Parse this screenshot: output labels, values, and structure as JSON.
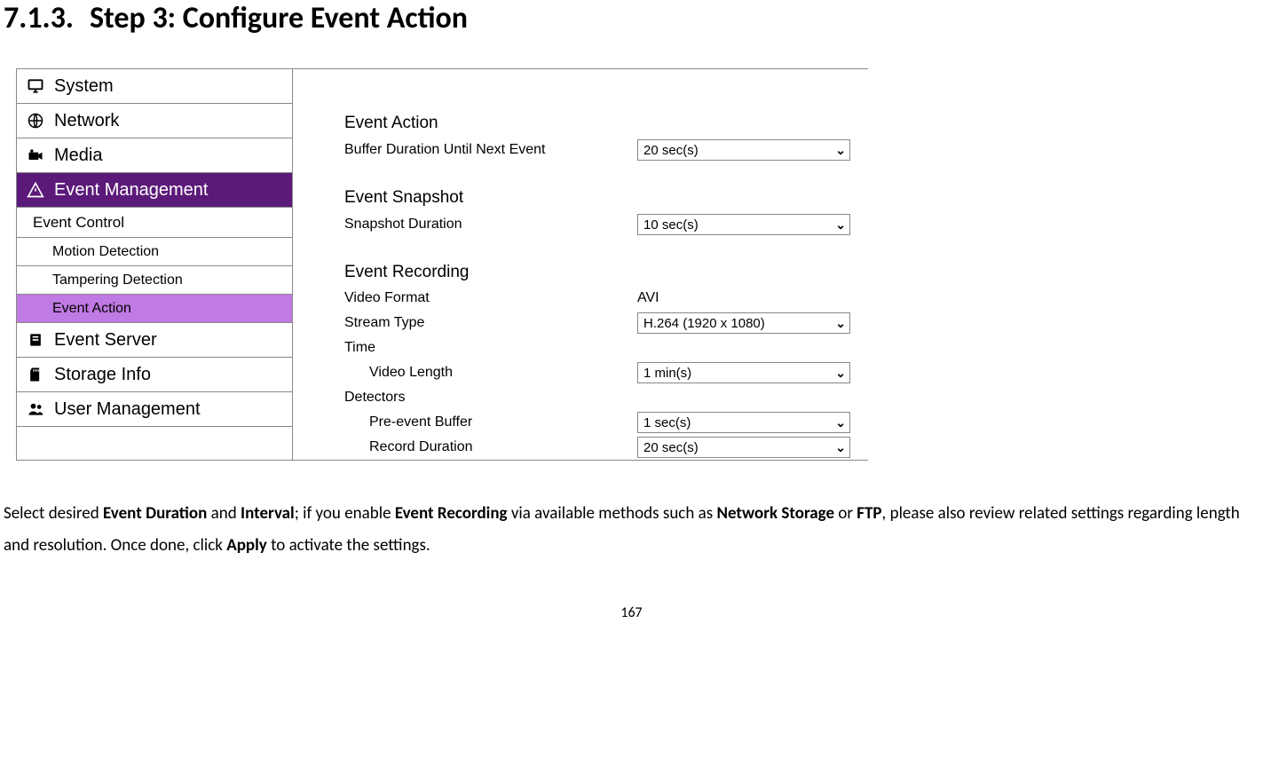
{
  "heading": {
    "number": "7.1.3.",
    "title": "Step 3: Configure Event Action"
  },
  "sidebar": {
    "items": [
      {
        "label": "System"
      },
      {
        "label": "Network"
      },
      {
        "label": "Media"
      },
      {
        "label": "Event Management"
      },
      {
        "label": "Event Control"
      },
      {
        "label": "Motion Detection"
      },
      {
        "label": "Tampering Detection"
      },
      {
        "label": "Event Action"
      },
      {
        "label": "Event Server"
      },
      {
        "label": "Storage Info"
      },
      {
        "label": "User Management"
      }
    ]
  },
  "content": {
    "event_action": {
      "title": "Event Action",
      "buffer_label": "Buffer Duration Until Next Event",
      "buffer_value": "20 sec(s)"
    },
    "event_snapshot": {
      "title": "Event Snapshot",
      "duration_label": "Snapshot Duration",
      "duration_value": "10 sec(s)"
    },
    "event_recording": {
      "title": "Event Recording",
      "video_format_label": "Video Format",
      "video_format_value": "AVI",
      "stream_type_label": "Stream Type",
      "stream_type_value": "H.264 (1920 x 1080)",
      "time_label": "Time",
      "video_length_label": "Video Length",
      "video_length_value": "1 min(s)",
      "detectors_label": "Detectors",
      "pre_event_buffer_label": "Pre-event Buffer",
      "pre_event_buffer_value": "1 sec(s)",
      "record_duration_label": "Record Duration",
      "record_duration_value": "20 sec(s)"
    }
  },
  "body_text": {
    "t1": "Select desired ",
    "b1": "Event Duration",
    "t2": " and ",
    "b2": "Interval",
    "t3": "; if you enable ",
    "b3": "Event Recording",
    "t4": " via available methods such as ",
    "b4": "Network Storage",
    "t5": " or ",
    "b5": "FTP",
    "t6": ", please also review related settings regarding length and resolution.    Once done, click ",
    "b6": "Apply",
    "t7": " to activate the settings."
  },
  "page_number": "167"
}
